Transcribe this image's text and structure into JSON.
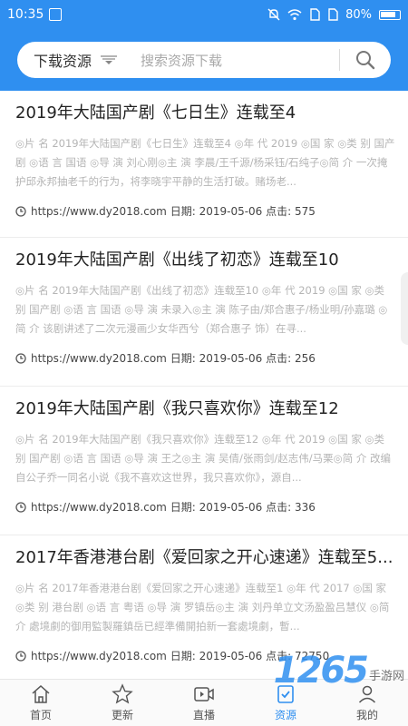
{
  "status_bar": {
    "time": "10:35",
    "battery": "80%"
  },
  "search": {
    "type_label": "下载资源",
    "placeholder": "搜索资源下载"
  },
  "items": [
    {
      "title": "2019年大陆国产剧《七日生》连载至4",
      "desc": "◎片 名 2019年大陆国产剧《七日生》连载至4 ◎年 代 2019 ◎国 家 ◎类 别 国产剧 ◎语 言 国语 ◎导 演 刘心刚◎主 演 李晨/王千源/杨采钰/石纯子◎简 介 一次掩护邱永邦抽老千的行为，将李晓宇平静的生活打破。赌场老...",
      "url": "https://www.dy2018.com",
      "date_label": "日期:",
      "date": "2019-05-06",
      "clicks_label": "点击:",
      "clicks": "575"
    },
    {
      "title": "2019年大陆国产剧《出线了初恋》连载至10",
      "desc": "◎片 名 2019年大陆国产剧《出线了初恋》连载至10 ◎年 代 2019 ◎国 家 ◎类 别 国产剧 ◎语 言 国语 ◎导 演 未录入◎主 演 陈子由/郑合惠子/杨业明/孙嘉璐 ◎简 介 该剧讲述了二次元漫画少女华西兮（郑合惠子 饰）在寻...",
      "url": "https://www.dy2018.com",
      "date_label": "日期:",
      "date": "2019-05-06",
      "clicks_label": "点击:",
      "clicks": "256"
    },
    {
      "title": "2019年大陆国产剧《我只喜欢你》连载至12",
      "desc": "◎片 名 2019年大陆国产剧《我只喜欢你》连载至12 ◎年 代 2019 ◎国 家 ◎类 别 国产剧 ◎语 言 国语 ◎导 演 王之◎主 演 吴倩/张雨剑/赵志伟/马栗◎简 介 改编自公子乔一同名小说《我不喜欢这世界，我只喜欢你》，源自...",
      "url": "https://www.dy2018.com",
      "date_label": "日期:",
      "date": "2019-05-06",
      "clicks_label": "点击:",
      "clicks": "336"
    },
    {
      "title": "2017年香港港台剧《爱回家之开心速递》连载至5...",
      "desc": "◎片 名 2017年香港港台剧《爱回家之开心速递》连载至1 ◎年 代 2017 ◎国 家 ◎类 别 港台剧 ◎语 言 粤语 ◎导 演 罗镇岳◎主 演 刘丹单立文汤盈盈吕慧仪 ◎简 介 處境劇的御用監製羅鎮岳已經準備開拍新一套處境劇，暫...",
      "url": "https://www.dy2018.com",
      "date_label": "日期:",
      "date": "2019-05-06",
      "clicks_label": "点击:",
      "clicks": "72750"
    }
  ],
  "tabs": [
    {
      "label": "首页",
      "icon": "home-icon",
      "active": false
    },
    {
      "label": "更新",
      "icon": "star-icon",
      "active": false
    },
    {
      "label": "直播",
      "icon": "video-icon",
      "active": false
    },
    {
      "label": "资源",
      "icon": "resource-icon",
      "active": true
    },
    {
      "label": "我的",
      "icon": "user-icon",
      "active": false
    }
  ],
  "watermark": {
    "number": "1265",
    "text": "手游网"
  },
  "colors": {
    "primary": "#2f8ff0",
    "title": "#222222",
    "desc": "#b5b5b5"
  }
}
